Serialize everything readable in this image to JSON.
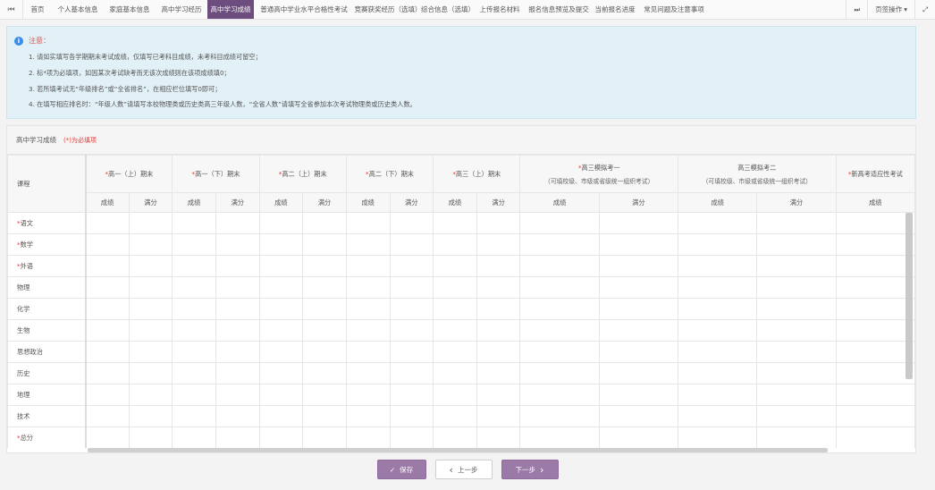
{
  "tabs": {
    "nav_prev": "⏮",
    "items": [
      "首页",
      "个人基本信息",
      "家庭基本信息",
      "高中学习经历",
      "高中学习成绩",
      "普通高中学业水平合格性考试",
      "竞赛获奖经历（选填）",
      "综合信息（选填）",
      "上传报名材料",
      "报名信息预览及提交",
      "当前报名进度",
      "常见问题及注意事项"
    ],
    "active_index": 4,
    "nav_next": "⏭",
    "page_ops": "页签操作",
    "page_ops_caret": "▾",
    "fullscreen": "⤢"
  },
  "notice": {
    "icon": "i",
    "title": "注意：",
    "lines": [
      "1. 请如实填写各学期期末考试成绩，仅填写已考科目成绩，未考科目成绩可留空；",
      "2. 标*项为必填项，如因某次考试缺考而无该次成绩则在该项成绩填0；",
      "3. 若所填考试无“年级排名”或“全省排名”，在相应栏位填写0即可；",
      "4. 在填写相应排名时：“年级人数”请填写本校物理类或历史类高三年级人数，“全省人数”请填写全省参加本次考试物理类或历史类人数。"
    ]
  },
  "panel": {
    "title": "高中学习成绩",
    "required_note": "(*)为必填项"
  },
  "table": {
    "course_header": "课程",
    "required_mark": "*",
    "groups": [
      {
        "label": "高一（上）期末",
        "required": true,
        "sub": ""
      },
      {
        "label": "高一（下）期末",
        "required": true,
        "sub": ""
      },
      {
        "label": "高二（上）期末",
        "required": true,
        "sub": ""
      },
      {
        "label": "高二（下）期末",
        "required": true,
        "sub": ""
      },
      {
        "label": "高三（上）期末",
        "required": true,
        "sub": ""
      },
      {
        "label": "高三模拟考一",
        "required": true,
        "sub": "（可填校级、市级或省级统一组织考试）"
      },
      {
        "label": "高三模拟考二",
        "required": false,
        "sub": "（可填校级、市级或省级统一组织考试）"
      },
      {
        "label": "新高考适应性考试",
        "required": true,
        "sub": ""
      }
    ],
    "score_label": "成绩",
    "full_label": "满分",
    "subjects": [
      {
        "name": "语文",
        "required": true
      },
      {
        "name": "数学",
        "required": true
      },
      {
        "name": "外语",
        "required": true
      },
      {
        "name": "物理",
        "required": false
      },
      {
        "name": "化学",
        "required": false
      },
      {
        "name": "生物",
        "required": false
      },
      {
        "name": "思想政治",
        "required": false
      },
      {
        "name": "历史",
        "required": false
      },
      {
        "name": "地理",
        "required": false
      },
      {
        "name": "技术",
        "required": false
      },
      {
        "name": "总分",
        "required": true
      }
    ]
  },
  "buttons": {
    "save": "保存",
    "save_icon": "✓",
    "prev": "上一步",
    "prev_icon": "‹",
    "next": "下一步",
    "next_icon": "›"
  },
  "colors": {
    "active_tab": "#6d4c7e",
    "primary_button": "#9b7aa8",
    "required": "#e33",
    "notice_bg": "#e2f1f8"
  }
}
